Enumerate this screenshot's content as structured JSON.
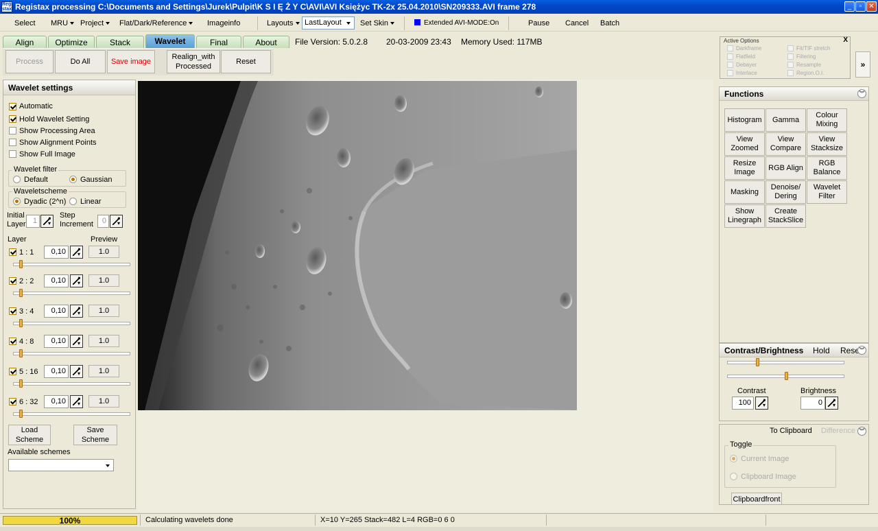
{
  "window": {
    "title": "Registax processing C:\\Documents and Settings\\Jurek\\Pulpit\\K S I Ę Ż Y C\\AVI\\AVI  Księżyc TK-2x  25.04.2010\\SN209333.AVI frame 278",
    "icon_text": "Regi stax"
  },
  "menu": {
    "select": "Select",
    "mru": "MRU",
    "project": "Project",
    "flat": "Flat/Dark/Reference",
    "imageinfo": "Imageinfo",
    "layouts": "Layouts",
    "layout_value": "LastLayout",
    "set_skin": "Set Skin",
    "avi_mode": "Extended AVI-MODE:On",
    "pause": "Pause",
    "cancel": "Cancel",
    "batch": "Batch"
  },
  "tabs": [
    "Align",
    "Optimize",
    "Stack",
    "Wavelet",
    "Final",
    "About"
  ],
  "info": {
    "version": "File Version: 5.0.2.8",
    "date": "20-03-2009 23:43",
    "memory": "Memory Used: 117MB"
  },
  "toolbar": {
    "process": "Process",
    "do_all": "Do All",
    "save_image": "Save image",
    "realign": "Realign_with Processed",
    "reset": "Reset"
  },
  "active_options": {
    "header": "Active Options",
    "close": "X",
    "left": [
      "Darkframe",
      "Flatfield",
      "Debayer",
      "Interlace"
    ],
    "right": [
      "Fit/TIF stretch",
      "Filtering",
      "Resample",
      "Region.O.I."
    ]
  },
  "expand_label": "»",
  "wavelet": {
    "title": "Wavelet settings",
    "automatic": "Automatic",
    "hold": "Hold Wavelet Setting",
    "show_area": "Show Processing Area",
    "show_points": "Show Alignment Points",
    "show_full": "Show Full Image",
    "filter_label": "Wavelet filter",
    "filter_default": "Default",
    "filter_gaussian": "Gaussian",
    "scheme_label": "Waveletscheme",
    "scheme_dyadic": "Dyadic (2^n)",
    "scheme_linear": "Linear",
    "initial_layer_l1": "Initial",
    "initial_layer_l2": "Layer",
    "initial_value": "1",
    "step_l1": "Step",
    "step_l2": "Increment",
    "step_value": "0",
    "layer_hdr": "Layer",
    "preview_hdr": "Preview",
    "layers": [
      {
        "label": "1 : 1",
        "value": "0,10",
        "preview": "1.0",
        "slider": 0.05
      },
      {
        "label": "2 : 2",
        "value": "0,10",
        "preview": "1.0",
        "slider": 0.05
      },
      {
        "label": "3 : 4",
        "value": "0,10",
        "preview": "1.0",
        "slider": 0.05
      },
      {
        "label": "4 : 8",
        "value": "0,10",
        "preview": "1.0",
        "slider": 0.05
      },
      {
        "label": "5 : 16",
        "value": "0,10",
        "preview": "1.0",
        "slider": 0.05
      },
      {
        "label": "6 : 32",
        "value": "0,10",
        "preview": "1.0",
        "slider": 0.05
      }
    ],
    "load_scheme": "Load Scheme",
    "save_scheme": "Save Scheme",
    "available": "Available schemes"
  },
  "functions": {
    "title": "Functions",
    "buttons": [
      "Histogram",
      "Gamma",
      "Colour Mixing",
      "View Zoomed",
      "View Compare",
      "View Stacksize",
      "Resize Image",
      "RGB Align",
      "RGB Balance",
      "Masking",
      "Denoise/ Dering",
      "Wavelet Filter",
      "Show Linegraph",
      "Create StackSlice"
    ]
  },
  "contrast": {
    "title": "Contrast/Brightness",
    "hold": "Hold",
    "reset": "Reset",
    "contrast_label": "Contrast",
    "contrast_value": "100",
    "brightness_label": "Brightness",
    "brightness_value": "0",
    "contrast_slider": 0.25,
    "brightness_slider": 0.5
  },
  "clipboard": {
    "to_clipboard": "To Clipboard",
    "difference": "Difference",
    "toggle": "Toggle",
    "current": "Current Image",
    "clip_image": "Clipboard Image",
    "front": "Clipboardfront"
  },
  "status": {
    "progress": "100%",
    "message": "Calculating wavelets done",
    "coords": "X=10 Y=265 Stack=482 L=4 RGB=0 6 0"
  }
}
